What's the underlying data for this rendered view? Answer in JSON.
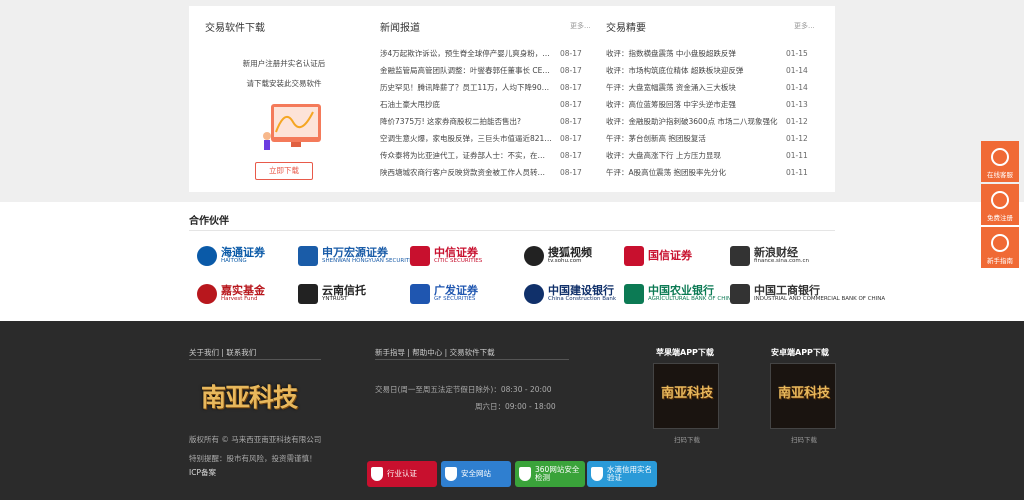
{
  "software": {
    "title": "交易软件下载",
    "line1": "新用户注册并实名认证后",
    "line2": "请下载安装此交易软件",
    "download_button": "立即下载"
  },
  "news": {
    "title": "新闻报道",
    "more": "更多...",
    "items": [
      {
        "title": "涉4万起欺诈诉讼，预生脊全球停产婴儿爽身粉，健...",
        "date": "08-17"
      },
      {
        "title": "金融监管局高管团队调整：叶燮春郭任董事长 CEO...",
        "date": "08-17"
      },
      {
        "title": "历史罕见！腾讯降薪了？员工11万，人均下降900...",
        "date": "08-17"
      },
      {
        "title": "石油土豪大甩抄底",
        "date": "08-17"
      },
      {
        "title": "降价7375万! 这家券商股权二拍能否售出?",
        "date": "08-17"
      },
      {
        "title": "空调生意火爆，家电股反弹，三巨头市值逼近821亿...",
        "date": "08-17"
      },
      {
        "title": "传众泰将为比亚迪代工，证券部人士：不实，在预...",
        "date": "08-17"
      },
      {
        "title": "陕西塘城农商行客户反映贷款资金被工作人员转走 ...",
        "date": "08-17"
      }
    ]
  },
  "summary": {
    "title": "交易精要",
    "more": "更多...",
    "items": [
      {
        "title": "收评：指数横盘震荡 中小盘股超跌反弹",
        "date": "01-15"
      },
      {
        "title": "收评：市场构筑底位精体 超跌板块迎反弹",
        "date": "01-14"
      },
      {
        "title": "午评：大盘宽幅震荡 资金涌入三大板块",
        "date": "01-14"
      },
      {
        "title": "收评：高位蓝筹股回落 中字头逆市走强",
        "date": "01-13"
      },
      {
        "title": "收评：金融股助沪指刺破3600点 市场二八现象强化",
        "date": "01-12"
      },
      {
        "title": "午评：茅台创新高 抱团股复活",
        "date": "01-12"
      },
      {
        "title": "收评：大盘高涨下行 上方压力显现",
        "date": "01-11"
      },
      {
        "title": "午评：A股高位震荡 抱团股率先分化",
        "date": "01-11"
      }
    ]
  },
  "partners": {
    "title": "合作伙伴",
    "logos": [
      {
        "cn": "海通证券",
        "en": "HAITONG",
        "color": "#0a5aa8"
      },
      {
        "cn": "申万宏源证券",
        "en": "SHENWAN HONGYUAN SECURITIES",
        "color": "#1a5ca8"
      },
      {
        "cn": "中信证券",
        "en": "CITIC SECURITIES",
        "color": "#c8102e"
      },
      {
        "cn": "搜狐视频",
        "en": "tv.sohu.com",
        "color": "#222222"
      },
      {
        "cn": "国信证券",
        "en": "",
        "color": "#c8102e"
      },
      {
        "cn": "新浪财经",
        "en": "finance.sina.com.cn",
        "color": "#333333"
      },
      {
        "cn": "嘉实基金",
        "en": "Harvest Fund",
        "color": "#b8171d"
      },
      {
        "cn": "云南信托",
        "en": "YNTRUST",
        "color": "#222222"
      },
      {
        "cn": "广发证券",
        "en": "GF SECURITIES",
        "color": "#1f56b0"
      },
      {
        "cn": "中国建设银行",
        "en": "China Construction Bank",
        "color": "#10306a"
      },
      {
        "cn": "中国农业银行",
        "en": "AGRICULTURAL BANK OF CHINA",
        "color": "#0c7a54"
      },
      {
        "cn": "中国工商银行",
        "en": "INDUSTRIAL AND COMMERCIAL BANK OF CHINA",
        "color": "#333333"
      }
    ]
  },
  "footer": {
    "about_links": "关于我们  |  联系我们",
    "help_links": "新手指导  |  帮助中心  |  交易软件下载",
    "trade_hours_1": "交易日(周一至周五法定节假日除外)：08:30 - 20:00",
    "trade_hours_2": "周六日：09:00 - 18:00",
    "logo_text": "南亚科技",
    "copyright": "版权所有 © 马来西亚南亚科技有限公司",
    "risk": "特别提醒：股市有风险，投资需谨慎！",
    "icp": "ICP备案",
    "ios_title": "苹果端APP下载",
    "android_title": "安卓端APP下载",
    "scan_caption": "扫码下载",
    "badges": [
      {
        "text": "行业认证",
        "color": "#c8102e"
      },
      {
        "text": "安全网站",
        "color": "#2f7fd0"
      },
      {
        "text": "360网站安全检测",
        "color": "#3aa33a"
      },
      {
        "text": "水滴信用实名验证",
        "color": "#2a9ad8"
      }
    ]
  },
  "sidebar": {
    "items": [
      {
        "label": "在线客服",
        "icon": "headset-icon"
      },
      {
        "label": "免费注册",
        "icon": "lightbulb-icon"
      },
      {
        "label": "新手指南",
        "icon": "location-pin-icon"
      }
    ]
  }
}
